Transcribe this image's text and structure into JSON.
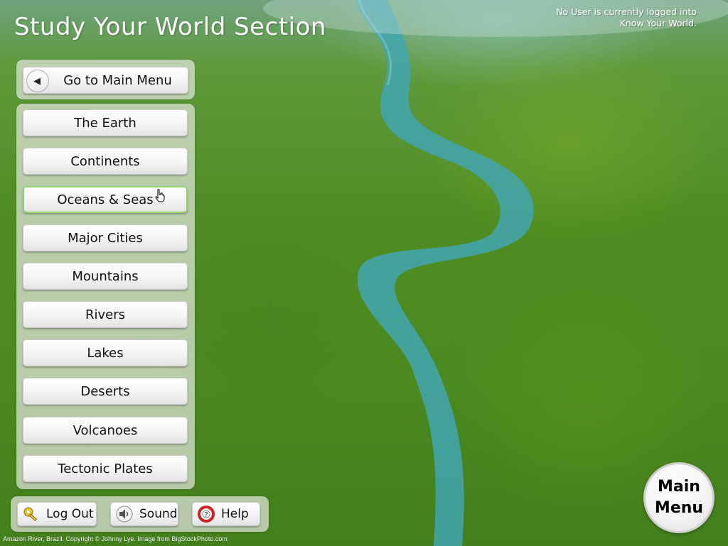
{
  "header": {
    "title": "Study Your World Section",
    "user_status": "No User is currently logged into Know Your World."
  },
  "nav": {
    "main_menu_label": "Go to Main Menu"
  },
  "topics": [
    {
      "label": "The Earth",
      "selected": false
    },
    {
      "label": "Continents",
      "selected": false
    },
    {
      "label": "Oceans & Seas",
      "selected": true
    },
    {
      "label": "Major Cities",
      "selected": false
    },
    {
      "label": "Mountains",
      "selected": false
    },
    {
      "label": "Rivers",
      "selected": false
    },
    {
      "label": "Lakes",
      "selected": false
    },
    {
      "label": "Deserts",
      "selected": false
    },
    {
      "label": "Volcanoes",
      "selected": false
    },
    {
      "label": "Tectonic Plates",
      "selected": false
    }
  ],
  "footer": {
    "logout_label": "Log Out",
    "sound_label": "Sound",
    "help_label": "Help",
    "main_menu_line1": "Main",
    "main_menu_line2": "Menu",
    "credit": "Amazon River, Brazil. Copyright © Johnny Lye. Image from BigStockPhoto.com"
  },
  "icons": {
    "back": "back-arrow-icon",
    "logout": "key-icon",
    "sound": "speaker-icon",
    "help": "lifebuoy-icon"
  },
  "colors": {
    "selected_border": "#8fd16a",
    "river": "#3fa3b2",
    "forest": "#4a8a1f"
  }
}
